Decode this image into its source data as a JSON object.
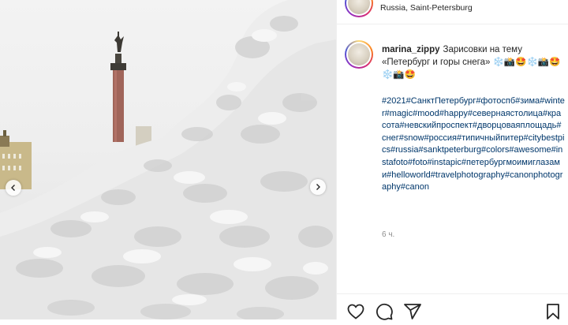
{
  "header": {
    "location": "Russia, Saint-Petersburg",
    "avatar_icon": "profile-avatar"
  },
  "caption": {
    "username": "marina_zippy",
    "text": "Зарисовки на тему «Петербург и горы снега» ❄️📸🤩❄️📸🤩❄️📸🤩",
    "hashtags": "#2021#СанктПетербург#фотоспб#зима#winter#magic#mood#happy#севернаястолица#красота#невскийпроспект#дворцоваяплощадь#снег#snow#россия#типичныйпитер#citybestpics#russia#sanktpeterburg#colors#awesome#instafoto#foto#instapic#петербургмоимиглазами#helloworld#travelphotography#canonphotography#canon",
    "time": "6 ч."
  },
  "photo": {
    "prev_icon": "chevron-left-icon",
    "next_icon": "chevron-right-icon"
  },
  "actions": {
    "icons": [
      "heart-icon",
      "comment-icon",
      "share-icon",
      "bookmark-icon"
    ]
  },
  "colors": {
    "hashtag": "#00376b",
    "meta": "#8e8e8e",
    "text": "#262626",
    "column": "#a0655a"
  }
}
